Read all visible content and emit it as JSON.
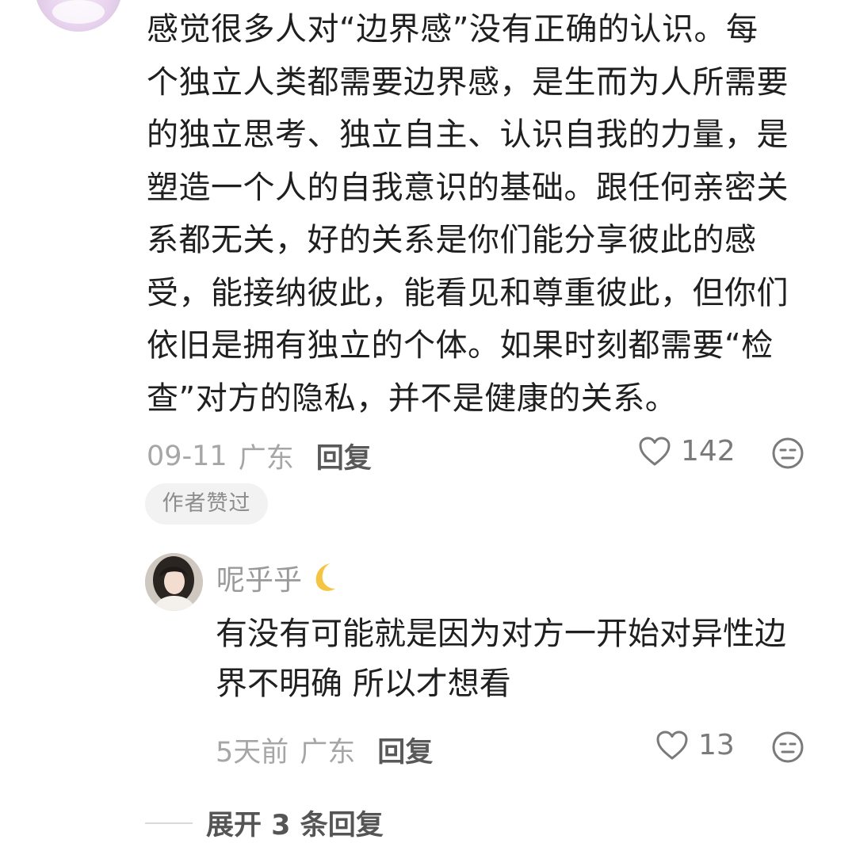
{
  "comment": {
    "avatar_icon": "avatar-icon",
    "lines": [
      "感觉很多人对“边界感”没有正确的认识。每",
      "个独立人类都需要边界感，是生而为人所需要",
      "的独立思考、独立自主、认识自我的力量，是",
      "塑造一个人的自我意识的基础。跟任何亲密关",
      "系都无关，好的关系是你们能分享彼此的感",
      "受，能接纳彼此，能看见和尊重彼此，但你们",
      "依旧是拥有独立的个体。如果时刻都需要“检",
      "查”对方的隐私，并不是健康的关系。"
    ],
    "date": "09-11",
    "location": "广东",
    "reply_label": "回复",
    "like_count": "142",
    "like_icon": "heart-icon",
    "emoji_icon": "emoji-face-icon",
    "author_badge": "作者赞过"
  },
  "reply": {
    "username": "呢乎乎",
    "username_emoji": "crescent-moon-icon",
    "lines": [
      "有没有可能就是因为对方一开始对异性边",
      "界不明确 所以才想看"
    ],
    "date": "5天前",
    "location": "广东",
    "reply_label": "回复",
    "like_count": "13",
    "like_icon": "heart-icon",
    "emoji_icon": "emoji-face-icon"
  },
  "expand": {
    "label": "展开 3 条回复"
  },
  "colors": {
    "text_primary": "#1f1f1f",
    "text_meta": "#a6a6a6",
    "reply_link": "#595959",
    "badge_bg": "#f2f2f2",
    "moon": "#f5c542"
  }
}
